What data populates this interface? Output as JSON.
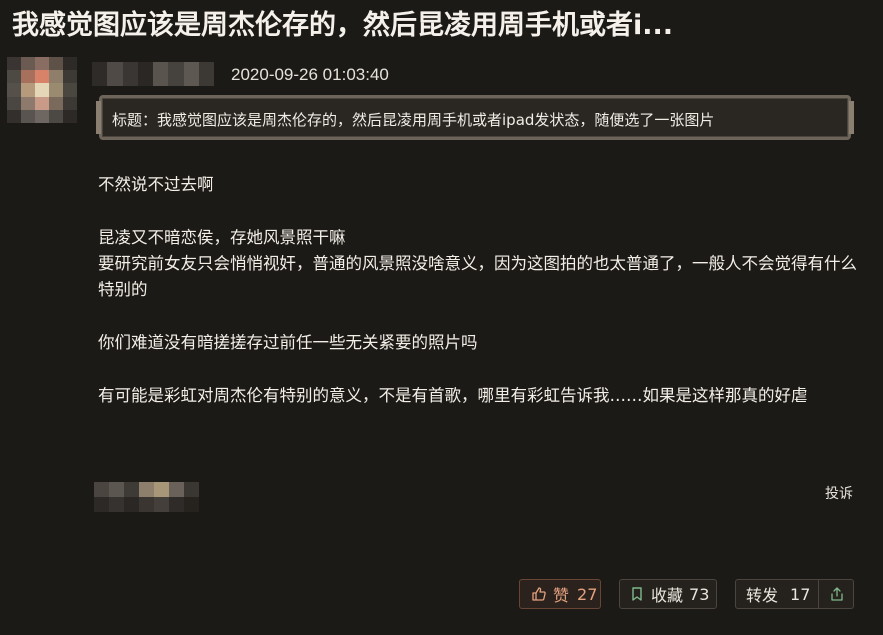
{
  "post": {
    "title": "我感觉图应该是周杰伦存的，然后昆凌用周手机或者i...",
    "timestamp": "2020-09-26 01:03:40",
    "subject": "标题：我感觉图应该是周杰伦存的，然后昆凌用周手机或者ipad发状态，随便选了一张图片",
    "paragraphs": [
      "不然说不过去啊",
      "昆凌又不暗恋侯，存她风景照干嘛\n要研究前女友只会悄悄视奸，普通的风景照没啥意义，因为这图拍的也太普通了，一般人不会觉得有什么特别的",
      "你们难道没有暗搓搓存过前任一些无关紧要的照片吗",
      "有可能是彩虹对周杰伦有特别的意义，不是有首歌，哪里有彩虹告诉我……如果是这样那真的好虐"
    ]
  },
  "actions": {
    "report_label": "投诉",
    "like_label": "赞",
    "like_count": "27",
    "favorite_label": "收藏",
    "favorite_count": "73",
    "share_label": "转发",
    "share_count": "17"
  },
  "icons": {
    "like": "thumbs-up-icon",
    "favorite": "bookmark-icon",
    "share": "share-arrow-icon"
  },
  "colors": {
    "background": "#1c1a17",
    "like_accent": "#e4a27f",
    "favorite_icon": "#7fb88a",
    "share_icon": "#7fb88a"
  }
}
